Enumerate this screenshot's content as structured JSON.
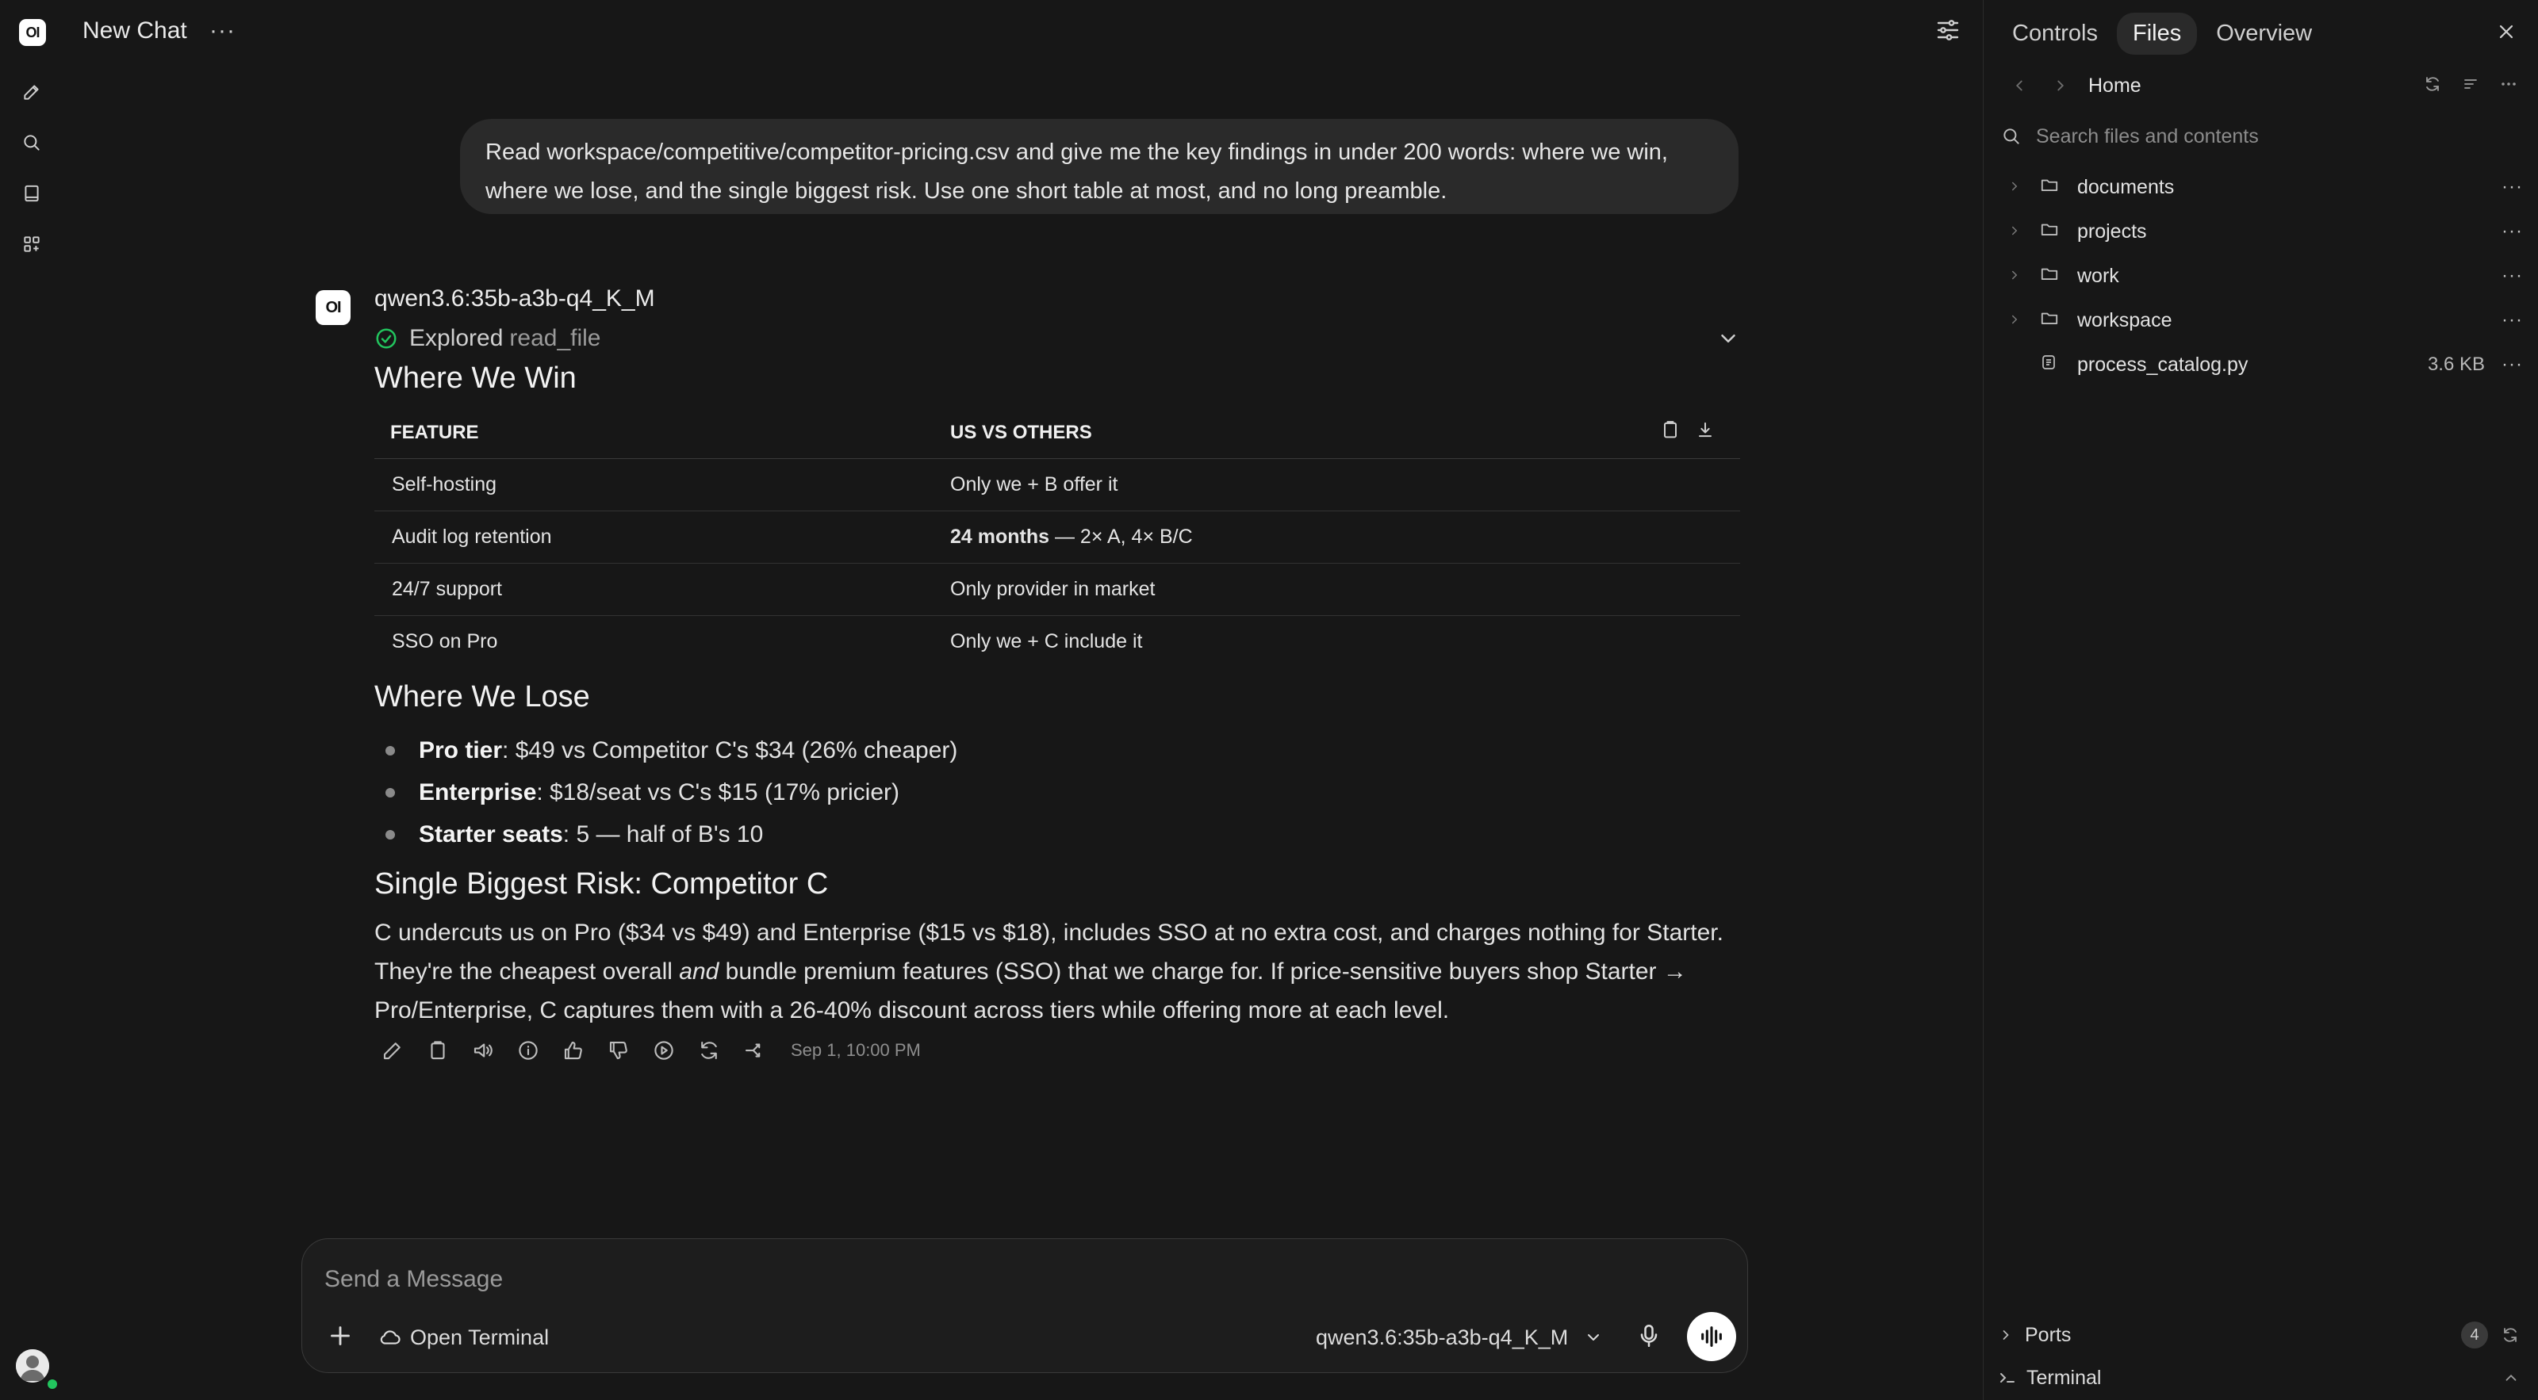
{
  "app": {
    "logo_text": "OI",
    "title": "New Chat",
    "more": "···"
  },
  "user_message": "Read workspace/competitive/competitor-pricing.csv and give me the key findings in under 200 words: where we win, where we lose, and the single biggest risk. Use one short table at most, and no long preamble.",
  "assistant": {
    "avatar_text": "OI",
    "model": "qwen3.6:35b-a3b-q4_K_M",
    "explored_label": "Explored",
    "explored_tool": "read_file",
    "win_heading": "Where We Win",
    "table": {
      "headers": [
        "FEATURE",
        "US VS OTHERS"
      ],
      "rows": [
        {
          "feature": "Self-hosting",
          "value_bold": "",
          "value": "Only we + B offer it"
        },
        {
          "feature": "Audit log retention",
          "value_bold": "24 months",
          "value": " — 2× A, 4× B/C"
        },
        {
          "feature": "24/7 support",
          "value_bold": "",
          "value": "Only provider in market"
        },
        {
          "feature": "SSO on Pro",
          "value_bold": "",
          "value": "Only we + C include it"
        }
      ]
    },
    "lose_heading": "Where We Lose",
    "lose_items": [
      {
        "bold": "Pro tier",
        "text": ": $49 vs Competitor C's $34 (26% cheaper)"
      },
      {
        "bold": "Enterprise",
        "text": ": $18/seat vs C's $15 (17% pricier)"
      },
      {
        "bold": "Starter seats",
        "text": ": 5 — half of B's 10"
      }
    ],
    "risk_heading": "Single Biggest Risk: Competitor C",
    "risk_before": "C undercuts us on Pro ($34 vs $49) and Enterprise ($15 vs $18), includes SSO at no extra cost, and charges nothing for Starter. They're the cheapest overall ",
    "risk_emph": "and",
    "risk_after": " bundle premium features (SSO) that we charge for. If price-sensitive buyers shop Starter → Pro/Enterprise, C captures them with a 26-40% discount across tiers while offering more at each level.",
    "timestamp": "Sep 1, 10:00 PM"
  },
  "composer": {
    "placeholder": "Send a Message",
    "terminal_label": "Open Terminal",
    "model": "qwen3.6:35b-a3b-q4_K_M"
  },
  "panel": {
    "tabs": [
      "Controls",
      "Files",
      "Overview"
    ],
    "active_tab": "Files",
    "breadcrumb": "Home",
    "search_placeholder": "Search files and contents",
    "files": [
      {
        "name": "documents",
        "type": "folder",
        "size": ""
      },
      {
        "name": "projects",
        "type": "folder",
        "size": ""
      },
      {
        "name": "work",
        "type": "folder",
        "size": ""
      },
      {
        "name": "workspace",
        "type": "folder",
        "size": ""
      },
      {
        "name": "process_catalog.py",
        "type": "file",
        "size": "3.6 KB"
      }
    ],
    "ports_label": "Ports",
    "ports_count": "4",
    "terminal_label": "Terminal"
  },
  "colors": {
    "background": "#171717",
    "bubble": "#2a2a2a",
    "success": "#22c55e",
    "avatar_online": "#22c55e"
  }
}
